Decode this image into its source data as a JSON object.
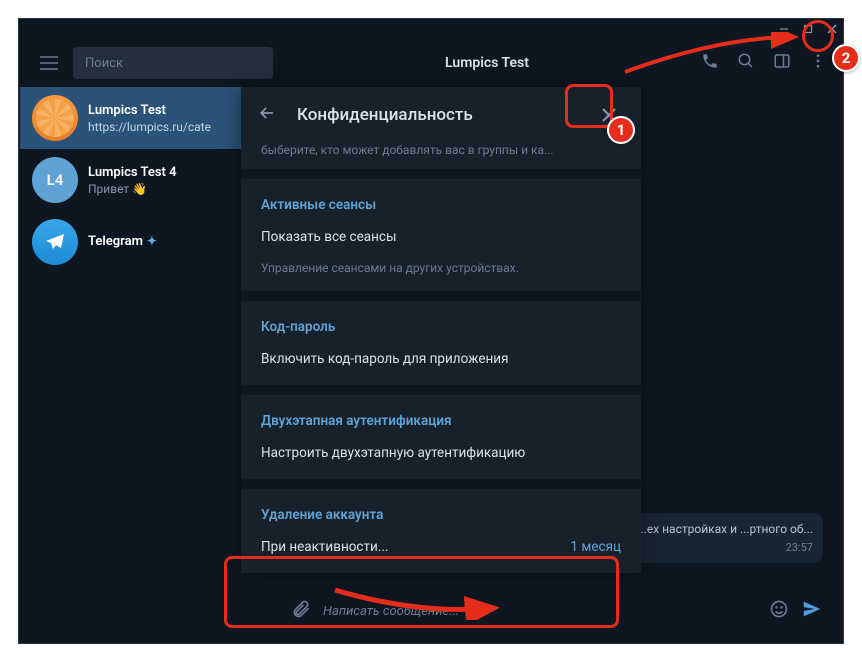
{
  "window": {
    "search_placeholder": "Поиск",
    "chat_title": "Lumpics Test"
  },
  "sidebar": {
    "items": [
      {
        "name": "Lumpics Test",
        "preview": "https://lumpics.ru/cate",
        "avatar_type": "orange",
        "avatar_text": "",
        "active": true
      },
      {
        "name": "Lumpics Test 4",
        "preview": "Привет 👋",
        "avatar_type": "blue",
        "avatar_text": "L4",
        "active": false
      },
      {
        "name": "Telegram",
        "preview": "",
        "avatar_type": "tg",
        "avatar_text": "",
        "active": false,
        "verified": true
      }
    ]
  },
  "panel": {
    "title": "Конфиденциальность",
    "top_cut_hint": "быберите, кто может добавлять вас в группы и ка...",
    "sections": [
      {
        "title": "Активные сеансы",
        "item": "Показать все сеансы",
        "hint": "Управление сеансами на других устройствах."
      },
      {
        "title": "Код-пароль",
        "item": "Включить код-пароль для приложения"
      },
      {
        "title": "Двухэтапная аутентификация",
        "item": "Настроить двухэтапную аутентификацию"
      },
      {
        "title": "Удаление аккаунта",
        "item": "При неактивности...",
        "value": "1 месяц"
      }
    ]
  },
  "bg_message": {
    "text": "...ех настройках и ...ртного об...",
    "time": "23:57"
  },
  "composer": {
    "placeholder": "Написать сообщение..."
  },
  "annotations": {
    "badge1": "1",
    "badge2": "2"
  }
}
